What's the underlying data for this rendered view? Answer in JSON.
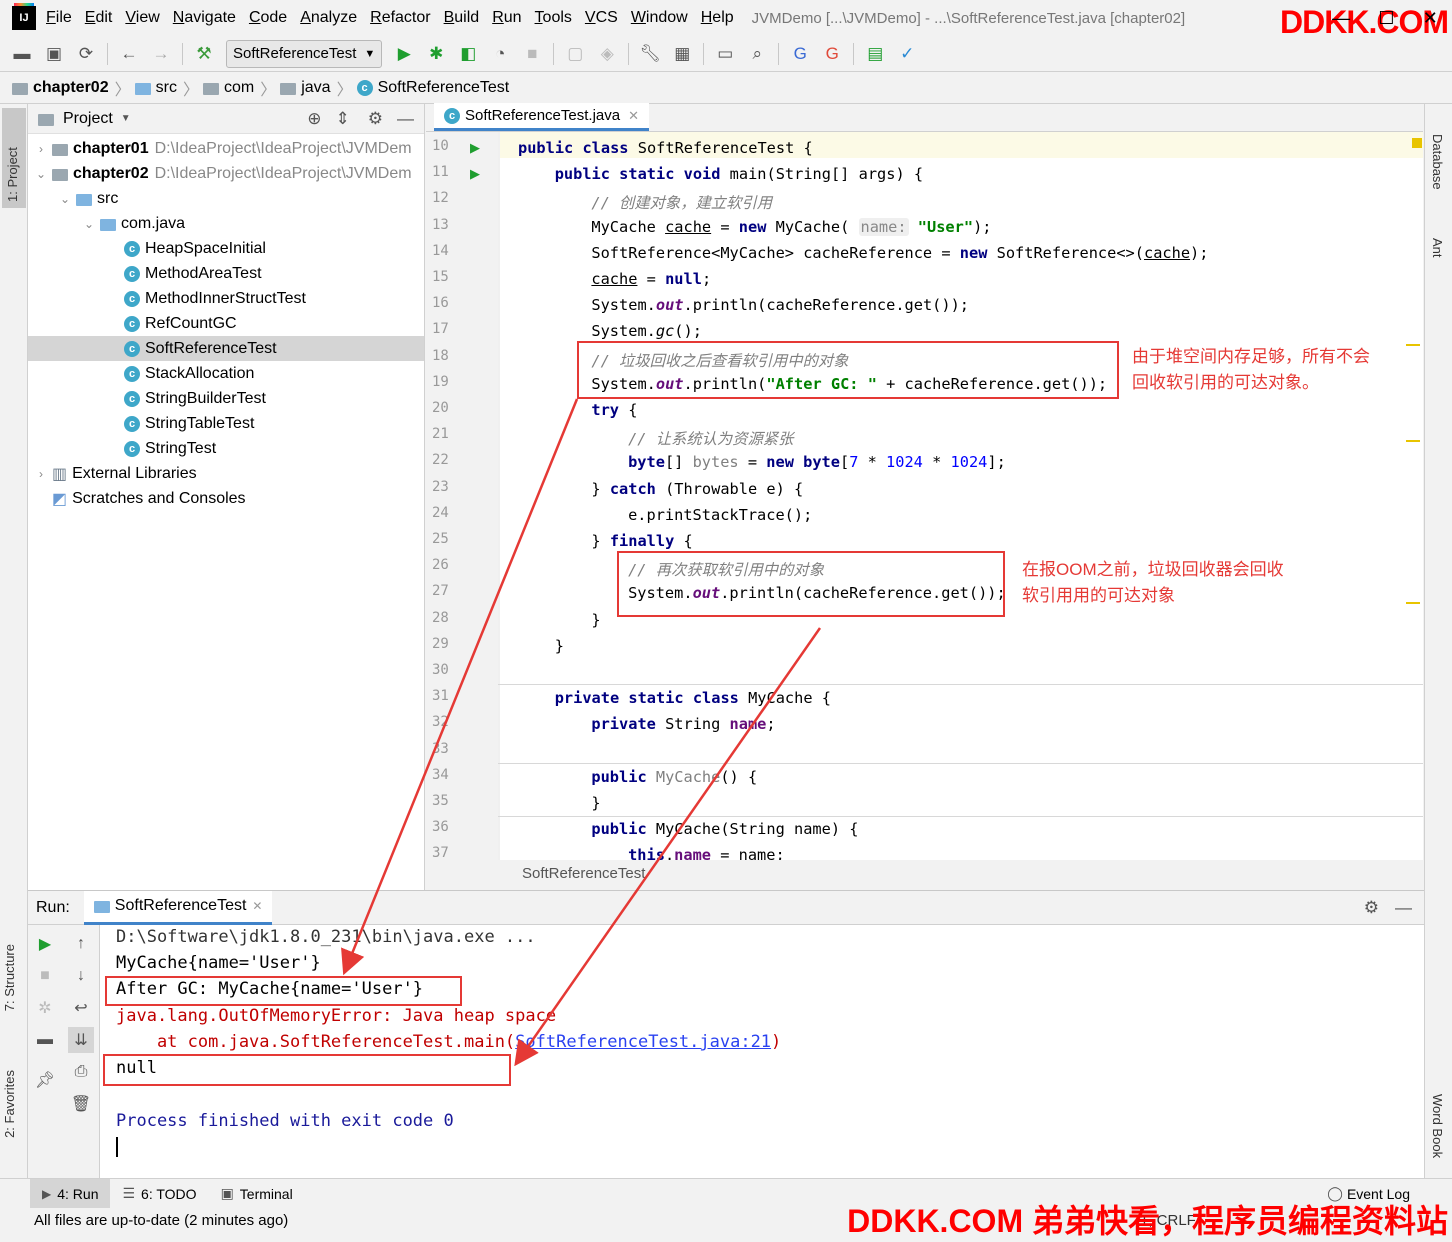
{
  "menubar": {
    "items": [
      "File",
      "Edit",
      "View",
      "Navigate",
      "Code",
      "Analyze",
      "Refactor",
      "Build",
      "Run",
      "Tools",
      "VCS",
      "Window",
      "Help"
    ],
    "window_title": "JVMDemo [...\\JVMDemo] - ...\\SoftReferenceTest.java [chapter02]",
    "watermark": "DDKK.COM"
  },
  "toolbar": {
    "run_config": "SoftReferenceTest"
  },
  "breadcrumb": [
    "chapter02",
    "src",
    "com",
    "java",
    "SoftReferenceTest"
  ],
  "side_tabs": {
    "left": [
      "1: Project",
      "7: Structure",
      "2: Favorites"
    ],
    "right": [
      "Database",
      "Ant",
      "Word Book"
    ]
  },
  "project": {
    "title": "Project",
    "tree": [
      {
        "label": "chapter01",
        "path": "D:\\IdeaProject\\IdeaProject\\JVMDem",
        "level": 0,
        "bold": true
      },
      {
        "label": "chapter02",
        "path": "D:\\IdeaProject\\IdeaProject\\JVMDem",
        "level": 0,
        "bold": true
      },
      {
        "label": "src",
        "level": 1
      },
      {
        "label": "com.java",
        "level": 2
      },
      {
        "label": "HeapSpaceInitial",
        "level": 3
      },
      {
        "label": "MethodAreaTest",
        "level": 3
      },
      {
        "label": "MethodInnerStructTest",
        "level": 3
      },
      {
        "label": "RefCountGC",
        "level": 3
      },
      {
        "label": "SoftReferenceTest",
        "level": 3,
        "selected": true
      },
      {
        "label": "StackAllocation",
        "level": 3
      },
      {
        "label": "StringBuilderTest",
        "level": 3
      },
      {
        "label": "StringTableTest",
        "level": 3
      },
      {
        "label": "StringTest",
        "level": 3
      },
      {
        "label": "External Libraries",
        "level": 0
      },
      {
        "label": "Scratches and Consoles",
        "level": 0
      }
    ]
  },
  "editor": {
    "tab": "SoftReferenceTest.java",
    "footer": "SoftReferenceTest",
    "line_numbers": [
      "10",
      "11",
      "12",
      "13",
      "14",
      "15",
      "16",
      "17",
      "18",
      "19",
      "20",
      "21",
      "22",
      "23",
      "24",
      "25",
      "26",
      "27",
      "28",
      "29",
      "30",
      "31",
      "32",
      "33",
      "34",
      "35",
      "36",
      "37"
    ],
    "code": {
      "l10": [
        "public class ",
        "SoftReferenceTest {"
      ],
      "l11": [
        "public static void ",
        "main(String[] args) {"
      ],
      "l12": "// 创建对象，建立软引用",
      "l13": [
        "MyCache ",
        "cache",
        " = ",
        "new ",
        "MyCache( ",
        "name:",
        " ",
        "\"User\"",
        ");"
      ],
      "l14": [
        "SoftReference<MyCache> cacheReference = ",
        "new ",
        "SoftReference<>(",
        "cache",
        ");"
      ],
      "l15": [
        "cache",
        " = ",
        "null",
        ";"
      ],
      "l16": [
        "System.",
        "out",
        ".println(cacheReference.get());"
      ],
      "l17": [
        "System.",
        "gc",
        "();"
      ],
      "l18": "// 垃圾回收之后查看软引用中的对象",
      "l19": [
        "System.",
        "out",
        ".println(",
        "\"After GC: \"",
        " + cacheReference.get());"
      ],
      "l20": [
        "try ",
        "{"
      ],
      "l21": "// 让系统认为资源紧张",
      "l22": [
        "byte",
        "[] ",
        "bytes",
        " = ",
        "new ",
        "byte",
        "[",
        "7",
        " * ",
        "1024",
        " * ",
        "1024",
        "];"
      ],
      "l23": [
        "} ",
        "catch ",
        "(Throwable e) {"
      ],
      "l24": "e.printStackTrace();",
      "l25": [
        "} ",
        "finally ",
        "{"
      ],
      "l26": "// 再次获取软引用中的对象",
      "l27": [
        "System.",
        "out",
        ".println(cacheReference.get());"
      ],
      "l28": "}",
      "l29": "}",
      "l31": [
        "private static class ",
        "MyCache {"
      ],
      "l32": [
        "private ",
        "String ",
        "name",
        ";"
      ],
      "l34": [
        "public ",
        "MyCache",
        "() {"
      ],
      "l35": "}",
      "l36": [
        "public ",
        "MyCache(String name) {"
      ],
      "l37": [
        "this",
        ".",
        "name",
        " = name;"
      ]
    }
  },
  "annotations": {
    "a1": [
      "由于堆空间内存足够，所有不会",
      "回收软引用的可达对象。"
    ],
    "a2": [
      "在报OOM之前，垃圾回收器会回收",
      "软引用用的可达对象"
    ]
  },
  "run": {
    "label": "Run:",
    "tab": "SoftReferenceTest",
    "console": {
      "cmd": "D:\\Software\\jdk1.8.0_231\\bin\\java.exe ...",
      "line1": "MyCache{name='User'}",
      "line2": "After GC: MyCache{name='User'}",
      "err1": "java.lang.OutOfMemoryError: Java heap space",
      "err2": "    at com.java.SoftReferenceTest.main(",
      "err2_link": "SoftReferenceTest.java:21",
      "err2_end": ")",
      "line3": "null",
      "exit": "Process finished with exit code 0"
    }
  },
  "bottom_tabs": [
    "4: Run",
    "6: TODO",
    "Terminal",
    "Event Log"
  ],
  "status": {
    "message": "All files are up-to-date (2 minutes ago)",
    "position": "1, CRLF",
    "watermark": "DDKK.COM 弟弟快看，程序员编程资料站"
  }
}
